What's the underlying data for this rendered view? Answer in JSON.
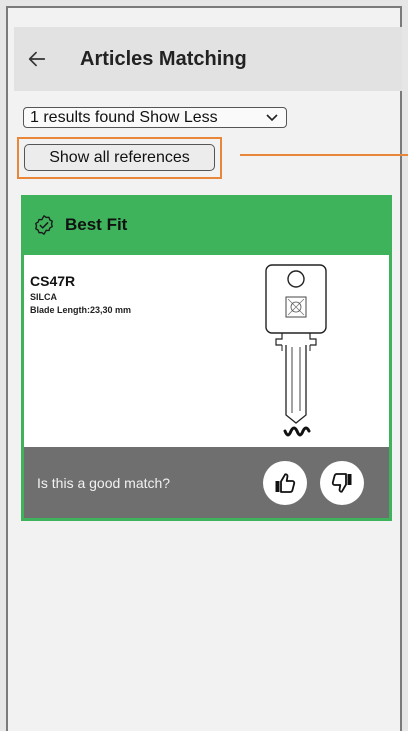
{
  "header": {
    "title": "Articles Matching",
    "back_icon": "arrow-left-icon"
  },
  "results_select": {
    "value": "1 results found Show Less"
  },
  "references_button": {
    "label": "Show all references"
  },
  "colors": {
    "accent": "#3fb25c",
    "annotation": "#e8873a",
    "footer": "#6f6f6f"
  },
  "card": {
    "badge": "Best Fit",
    "badge_icon": "check-badge-icon",
    "part_number": "CS47R",
    "brand": "SILCA",
    "blade_length": "Blade Length:23,30 mm",
    "question": "Is this a good match?",
    "thumbs_up_icon": "thumbs-up-icon",
    "thumbs_down_icon": "thumbs-down-icon"
  }
}
